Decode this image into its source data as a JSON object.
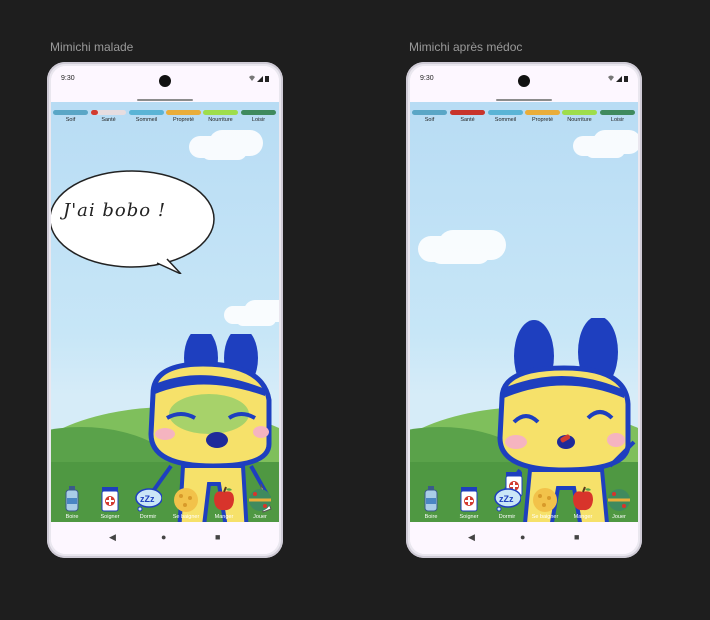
{
  "frames": [
    {
      "label": "Mimichi malade",
      "status_time": "9:30",
      "speech": "J'ai bobo !",
      "stats": [
        {
          "label": "Soif",
          "color": "#5aa6c6",
          "level": 1.0
        },
        {
          "label": "Santé",
          "color": "#d23b2f",
          "level": 0.2
        },
        {
          "label": "Sommeil",
          "color": "#5ab4d6",
          "level": 1.0
        },
        {
          "label": "Propreté",
          "color": "#e9ad3a",
          "level": 1.0
        },
        {
          "label": "Nourriture",
          "color": "#9edd4c",
          "level": 1.0
        },
        {
          "label": "Loisir",
          "color": "#3f8a5e",
          "level": 1.0
        }
      ],
      "actions": [
        {
          "label": "Boire",
          "icon": "water-bottle-icon"
        },
        {
          "label": "Soigner",
          "icon": "medicine-bottle-icon"
        },
        {
          "label": "Dormir",
          "icon": "zzz-cloud-icon"
        },
        {
          "label": "Se baigner",
          "icon": "sponge-icon"
        },
        {
          "label": "Manger",
          "icon": "apple-icon"
        },
        {
          "label": "Jouer",
          "icon": "ball-icon"
        }
      ]
    },
    {
      "label": "Mimichi après médoc",
      "status_time": "9:30",
      "stats": [
        {
          "label": "Soif",
          "color": "#5aa6c6",
          "level": 1.0
        },
        {
          "label": "Santé",
          "color": "#c8342b",
          "level": 1.0
        },
        {
          "label": "Sommeil",
          "color": "#5ab4d6",
          "level": 1.0
        },
        {
          "label": "Propreté",
          "color": "#e9ad3a",
          "level": 1.0
        },
        {
          "label": "Nourriture",
          "color": "#9edd4c",
          "level": 1.0
        },
        {
          "label": "Loisir",
          "color": "#3f8a5e",
          "level": 1.0
        }
      ],
      "actions": [
        {
          "label": "Boire",
          "icon": "water-bottle-icon"
        },
        {
          "label": "Soigner",
          "icon": "medicine-bottle-icon"
        },
        {
          "label": "Dormir",
          "icon": "zzz-cloud-icon"
        },
        {
          "label": "Se baigner",
          "icon": "sponge-icon"
        },
        {
          "label": "Manger",
          "icon": "apple-icon"
        },
        {
          "label": "Jouer",
          "icon": "ball-icon"
        }
      ]
    }
  ],
  "nav": {
    "back": "◀",
    "home": "●",
    "recents": "■"
  }
}
